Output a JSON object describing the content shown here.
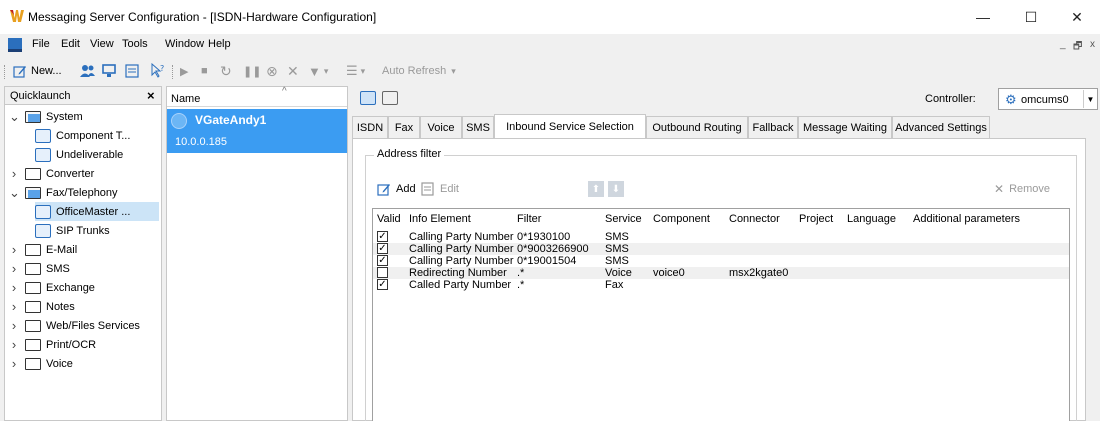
{
  "window": {
    "title": "Messaging Server Configuration - [ISDN-Hardware Configuration]",
    "minimize": "—",
    "maximize": "☐",
    "close": "✕"
  },
  "menu": {
    "items": [
      "File",
      "Edit",
      "View",
      "Tools",
      "Window",
      "Help"
    ],
    "mdi_min": "_",
    "mdi_restore": "🗗",
    "mdi_close": "x"
  },
  "toolbar": {
    "new_label": "New...",
    "auto_refresh_label": "Auto Refresh",
    "dropdown_arrow": "▾"
  },
  "quicklaunch": {
    "title": "Quicklaunch",
    "close": "×",
    "tree": [
      {
        "label": "System",
        "level": 0,
        "expander": "open"
      },
      {
        "label": "Component T...",
        "level": 1
      },
      {
        "label": "Undeliverable",
        "level": 1
      },
      {
        "label": "Converter",
        "level": 0,
        "expander": "closed"
      },
      {
        "label": "Fax/Telephony",
        "level": 0,
        "expander": "open"
      },
      {
        "label": "OfficeMaster ...",
        "level": 1,
        "selected": true
      },
      {
        "label": "SIP Trunks",
        "level": 1
      },
      {
        "label": "E-Mail",
        "level": 0,
        "expander": "closed"
      },
      {
        "label": "SMS",
        "level": 0,
        "expander": "closed"
      },
      {
        "label": "Exchange",
        "level": 0,
        "expander": "closed"
      },
      {
        "label": "Notes",
        "level": 0,
        "expander": "closed"
      },
      {
        "label": "Web/Files Services",
        "level": 0,
        "expander": "closed"
      },
      {
        "label": "Print/OCR",
        "level": 0,
        "expander": "closed"
      },
      {
        "label": "Voice",
        "level": 0,
        "expander": "closed"
      }
    ]
  },
  "namelist": {
    "header": "Name",
    "sort_indicator": "^",
    "items": [
      {
        "name": "VGateAndy1",
        "ip": "10.0.0.185"
      }
    ]
  },
  "controller": {
    "label": "Controller:",
    "value": "omcums0"
  },
  "tabs": [
    "ISDN",
    "Fax",
    "Voice",
    "SMS",
    "Inbound Service Selection",
    "Outbound Routing",
    "Fallback",
    "Message Waiting",
    "Advanced Settings"
  ],
  "active_tab": "Inbound Service Selection",
  "address_filter": {
    "title": "Address filter",
    "add_label": "Add",
    "edit_label": "Edit",
    "remove_label": "Remove",
    "columns": [
      "Valid",
      "Info Element",
      "Filter",
      "Service",
      "Component",
      "Connector",
      "Project",
      "Language",
      "Additional parameters"
    ],
    "rows": [
      {
        "valid": true,
        "info_element": "Calling Party Number",
        "filter": "0*1930100",
        "service": "SMS",
        "component": "",
        "connector": ""
      },
      {
        "valid": true,
        "info_element": "Calling Party Number",
        "filter": "0*9003266900",
        "service": "SMS",
        "component": "",
        "connector": ""
      },
      {
        "valid": true,
        "info_element": "Calling Party Number",
        "filter": "0*19001504",
        "service": "SMS",
        "component": "",
        "connector": ""
      },
      {
        "valid": false,
        "info_element": "Redirecting Number",
        "filter": ".*",
        "service": "Voice",
        "component": "voice0",
        "connector": "msx2kgate0"
      },
      {
        "valid": true,
        "info_element": "Called Party Number",
        "filter": ".*",
        "service": "Fax",
        "component": "",
        "connector": ""
      }
    ]
  },
  "colors": {
    "selection_blue": "#3b9cf2",
    "tree_selection": "#cce4f7",
    "accent": "#2b6fbd"
  }
}
